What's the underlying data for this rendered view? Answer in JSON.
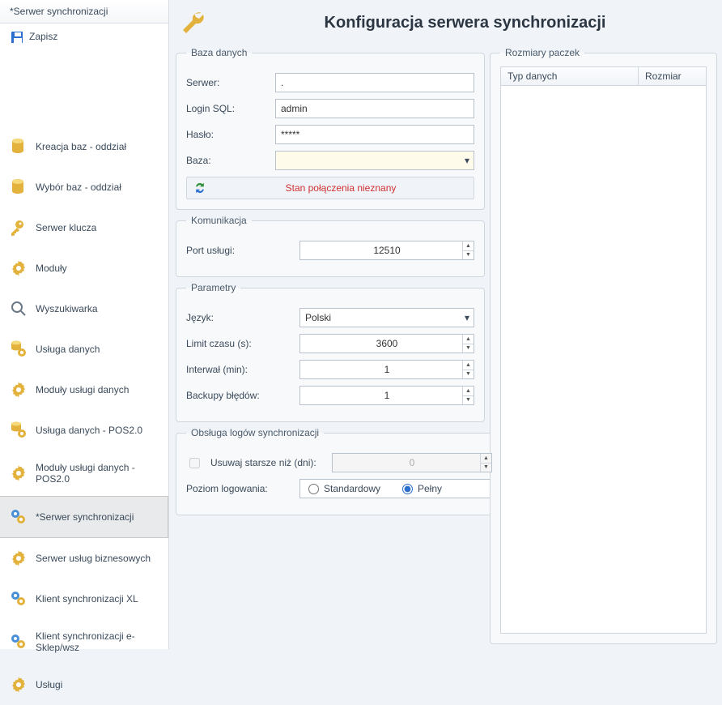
{
  "sidebar": {
    "header": "*Serwer synchronizacji",
    "save": "Zapisz",
    "items": [
      {
        "label": "Kreacja baz - oddział",
        "icon": "db-create"
      },
      {
        "label": "Wybór baz - oddział",
        "icon": "db-select"
      },
      {
        "label": "Serwer klucza",
        "icon": "key"
      },
      {
        "label": "Moduły",
        "icon": "gear"
      },
      {
        "label": "Wyszukiwarka",
        "icon": "magnify"
      },
      {
        "label": "Usługa danych",
        "icon": "db-gear"
      },
      {
        "label": "Moduły usługi danych",
        "icon": "gear"
      },
      {
        "label": "Usługa danych - POS2.0",
        "icon": "db-gear"
      },
      {
        "label": "Moduły usługi danych - POS2.0",
        "icon": "gear"
      },
      {
        "label": "*Serwer synchronizacji",
        "icon": "sync-gears"
      },
      {
        "label": "Serwer usług biznesowych",
        "icon": "gear"
      },
      {
        "label": "Klient synchronizacji XL",
        "icon": "sync-gears"
      },
      {
        "label": "Klient synchronizacji e-Sklep/wsz",
        "icon": "sync-gears"
      },
      {
        "label": "Usługi",
        "icon": "gear"
      }
    ],
    "selected_index": 9
  },
  "header": {
    "title": "Konfiguracja serwera synchronizacji"
  },
  "db": {
    "legend": "Baza danych",
    "server_label": "Serwer:",
    "server": ".",
    "login_label": "Login SQL:",
    "login": "admin",
    "password_label": "Hasło:",
    "password": "*****",
    "base_label": "Baza:",
    "base": "",
    "status": "Stan połączenia nieznany"
  },
  "comm": {
    "legend": "Komunikacja",
    "port_label": "Port usługi:",
    "port": "12510"
  },
  "params": {
    "legend": "Parametry",
    "lang_label": "Język:",
    "lang": "Polski",
    "timeout_label": "Limit czasu (s):",
    "timeout": "3600",
    "interval_label": "Interwał (min):",
    "interval": "1",
    "backups_label": "Backupy błędów:",
    "backups": "1"
  },
  "logs": {
    "legend": "Obsługa logów synchronizacji",
    "delete_label": "Usuwaj starsze niż (dni):",
    "delete_days": "0",
    "level_label": "Poziom logowania:",
    "level_standard": "Standardowy",
    "level_full": "Pełny",
    "level_selected": "full"
  },
  "sizes": {
    "legend": "Rozmiary paczek",
    "col_type": "Typ danych",
    "col_size": "Rozmiar"
  }
}
